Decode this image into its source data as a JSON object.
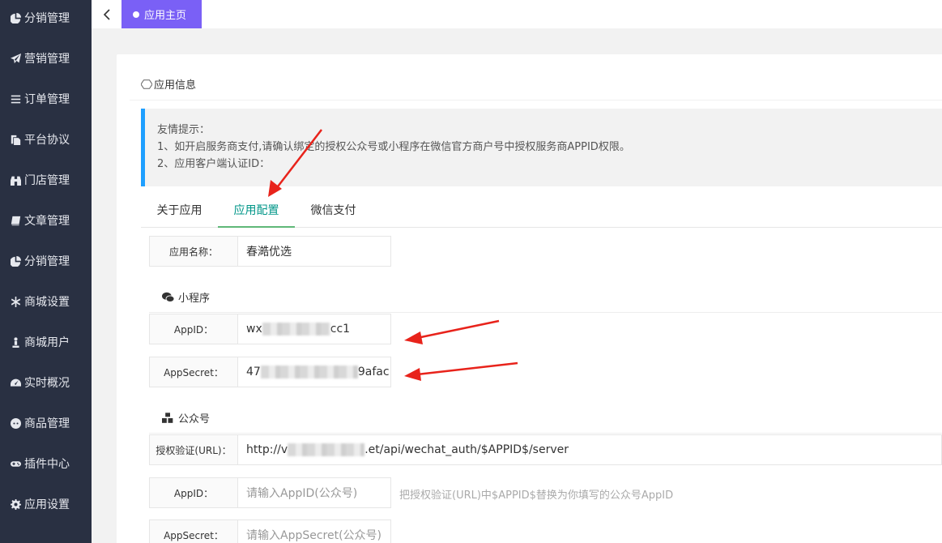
{
  "sidebar": {
    "items": [
      {
        "label": "分销管理",
        "icon": "pie-chart-icon"
      },
      {
        "label": "营销管理",
        "icon": "paper-plane-icon"
      },
      {
        "label": "订单管理",
        "icon": "list-icon"
      },
      {
        "label": "平台协议",
        "icon": "copy-icon"
      },
      {
        "label": "门店管理",
        "icon": "binoculars-icon"
      },
      {
        "label": "文章管理",
        "icon": "book-icon"
      },
      {
        "label": "分销管理",
        "icon": "pie-chart-icon"
      },
      {
        "label": "商城设置",
        "icon": "asterisk-icon"
      },
      {
        "label": "商城用户",
        "icon": "user-icon"
      },
      {
        "label": "实时概况",
        "icon": "dashboard-icon"
      },
      {
        "label": "商品管理",
        "icon": "reddit-icon"
      },
      {
        "label": "插件中心",
        "icon": "gamepad-icon"
      },
      {
        "label": "应用设置",
        "icon": "gear-icon"
      }
    ]
  },
  "topbar": {
    "home_tab": "应用主页"
  },
  "card": {
    "title": "应用信息"
  },
  "notice": {
    "title": "友情提示：",
    "line1": "1、如开启服务商支付,请确认绑定的授权公众号或小程序在微信官方商户号中授权服务商APPID权限。",
    "line2": "2、应用客户端认证ID："
  },
  "tabs": [
    {
      "label": "关于应用",
      "active": false
    },
    {
      "label": "应用配置",
      "active": true
    },
    {
      "label": "微信支付",
      "active": false
    }
  ],
  "form": {
    "app_name": {
      "label": "应用名称：",
      "value": "春澔优选"
    },
    "mini_section": "小程序",
    "mini_appid": {
      "label": "AppID：",
      "prefix": "wx",
      "suffix": "cc1"
    },
    "mini_secret": {
      "label": "AppSecret：",
      "prefix": "47",
      "suffix": "9afac"
    },
    "mp_section": "公众号",
    "auth_url": {
      "label": "授权验证(URL)：",
      "prefix": "http://v",
      "suffix": ".et/api/wechat_auth/$APPID$/server"
    },
    "mp_appid": {
      "label": "AppID：",
      "placeholder": "请输入AppID(公众号)",
      "hint": "把授权验证(URL)中$APPID$替换为你填写的公众号AppID"
    },
    "mp_secret": {
      "label": "AppSecret：",
      "placeholder": "请输入AppSecret(公众号)"
    }
  },
  "colors": {
    "sidebar": "#293042",
    "accent": "#7a60f6",
    "tab_active": "#009688",
    "notice_border": "#1e9fff",
    "arrow": "#e8231b"
  }
}
